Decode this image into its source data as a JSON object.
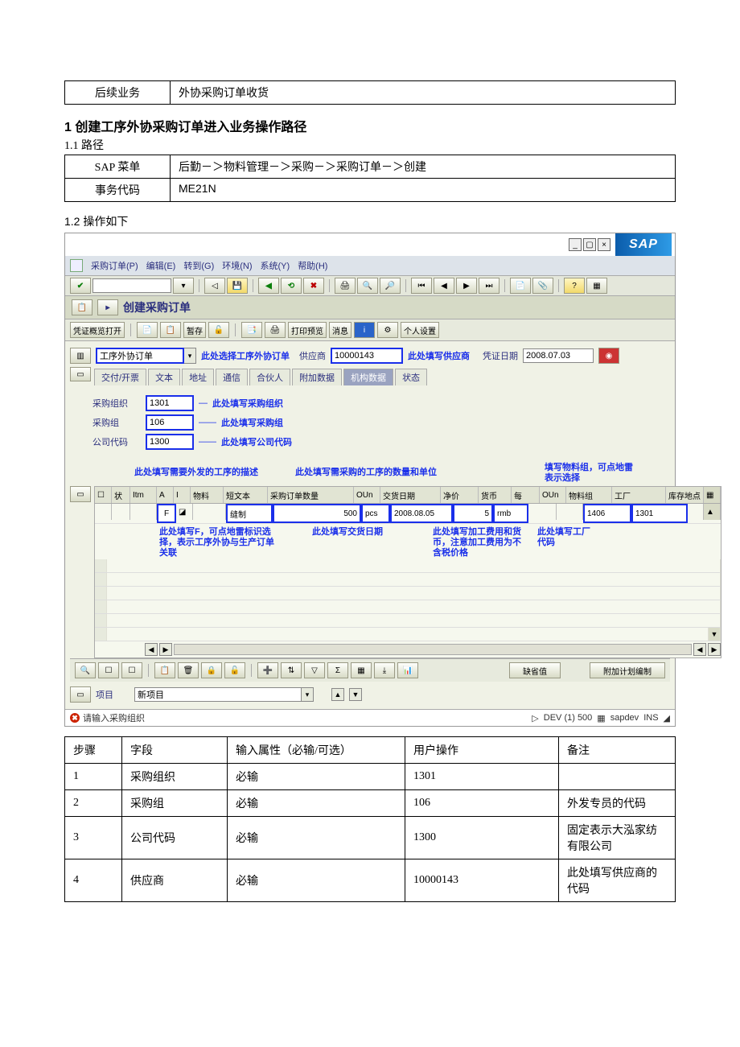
{
  "top_table": {
    "label": "后续业务",
    "value": "外协采购订单收货"
  },
  "section1_title": "1 创建工序外协采购订单进入业务操作路径",
  "section1_1": "1.1 路径",
  "path_table": {
    "r1_label": "SAP 菜单",
    "r1_value": "后勤－＞物料管理－＞采购－＞采购订单－＞创建",
    "r2_label": "事务代码",
    "r2_value": "ME21N"
  },
  "section1_2": "1.2 操作如下",
  "sap": {
    "logo": "SAP",
    "menu": {
      "m1": "采购订单(P)",
      "m2": "编辑(E)",
      "m3": "转到(G)",
      "m4": "环境(N)",
      "m5": "系统(Y)",
      "m6": "帮助(H)"
    },
    "screen_title": "创建采购订单",
    "tbar2": {
      "b1": "凭证概览打开",
      "b2": "暂存",
      "b3": "打印预览",
      "b4": "消息",
      "b5": "个人设置"
    },
    "header": {
      "doctype": "工序外协订单",
      "ann_doctype": "此处选择工序外协订单",
      "vendor_label": "供应商",
      "vendor": "10000143",
      "ann_vendor": "此处填写供应商",
      "docdate_label": "凭证日期",
      "docdate": "2008.07.03"
    },
    "tabs": {
      "t1": "交付/开票",
      "t2": "文本",
      "t3": "地址",
      "t4": "通信",
      "t5": "合伙人",
      "t6": "附加数据",
      "t7": "机构数据",
      "t8": "状态"
    },
    "org": {
      "l1": "采购组织",
      "v1": "1301",
      "a1": "此处填写采购组织",
      "l2": "采购组",
      "v2": "106",
      "a2": "此处填写采购组",
      "l3": "公司代码",
      "v3": "1300",
      "a3": "此处填写公司代码"
    },
    "mid_annotations": {
      "shorttext": "此处填写需要外发的工序的描述",
      "qty": "此处填写需采购的工序的数量和单位",
      "matgroup": "填写物料组，可点地雷表示选择"
    },
    "grid_headers": {
      "c0": "状",
      "c1": "Itm",
      "c2": "A",
      "c3": "I",
      "c4": "物料",
      "c5": "短文本",
      "c6": "采购订单数量",
      "c7": "OUn",
      "c8": "交货日期",
      "c9": "净价",
      "c10": "货币",
      "c11": "每",
      "c12": "OUn",
      "c13": "物料组",
      "c14": "工厂",
      "c15": "库存地点"
    },
    "grid_row": {
      "a": "F",
      "shorttext": "缝制",
      "qty": "500",
      "oun": "pcs",
      "deldate": "2008.08.05",
      "price": "5",
      "curr": "rmb",
      "matgroup": "1406",
      "plant": "1301"
    },
    "lower_annotations": {
      "a_left": "此处填写F，可点地雷标识选择，表示工序外协与生产订单关联",
      "a_deldate": "此处填写交货日期",
      "a_price": "此处填写加工费用和货币，注意加工费用为不含税价格",
      "a_plant": "此处填写工厂代码"
    },
    "bottom_buttons": {
      "b1": "缺省值",
      "b2": "附加计划编制"
    },
    "item_section": {
      "label": "项目",
      "value": "新项目"
    },
    "status": {
      "msg": "请输入采购组织",
      "sys": "DEV (1) 500",
      "srv": "sapdev",
      "mode": "INS"
    }
  },
  "steps_table": {
    "h1": "步骤",
    "h2": "字段",
    "h3": "输入属性（必输/可选）",
    "h4": "用户操作",
    "h5": "备注",
    "rows": [
      {
        "n": "1",
        "field": "采购组织",
        "attr": "必输",
        "op": "1301",
        "note": ""
      },
      {
        "n": "2",
        "field": "采购组",
        "attr": "必输",
        "op": "106",
        "note": "外发专员的代码"
      },
      {
        "n": "3",
        "field": "公司代码",
        "attr": "必输",
        "op": "1300",
        "note": "固定表示大泓家纺有限公司"
      },
      {
        "n": "4",
        "field": "供应商",
        "attr": "必输",
        "op": "10000143",
        "note": "此处填写供应商的代码"
      }
    ]
  }
}
